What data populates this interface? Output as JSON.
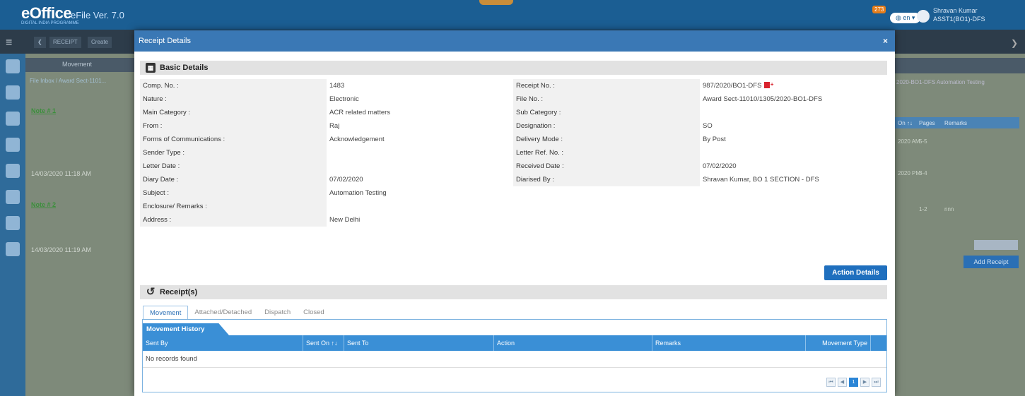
{
  "app": {
    "logo": "eOffice",
    "logo_sub": "DIGITAL INDIA PROGRAMME",
    "version": "eFile Ver. 7.0",
    "notification_count": "273",
    "language": "en",
    "user_name": "Shravan Kumar",
    "user_role": "ASST1(BO1)-DFS"
  },
  "breadcrumb_bar": {
    "receipt": "RECEIPT",
    "create": "Create"
  },
  "background": {
    "toolbar_label": "Movement",
    "file_link": "File Inbox / Award Sect-1101...",
    "notes": [
      {
        "label": "Note # 1",
        "time": "14/03/2020 11:18 AM"
      },
      {
        "label": "Note # 2",
        "time": "14/03/2020 11:19 AM"
      }
    ],
    "right_header": "2020-BO1-DFS  Automation Testing",
    "right_cols": [
      "On ↑↓",
      "Pages",
      "Remarks"
    ],
    "right_rows": [
      {
        "date": "2020 AM",
        "pages": "5-5",
        "remarks": ""
      },
      {
        "date": "2020 PM",
        "pages": "3-4",
        "remarks": ""
      },
      {
        "date": "",
        "pages": "1-2",
        "remarks": "nnn"
      }
    ],
    "add_receipt": "Add Receipt"
  },
  "modal": {
    "title": "Receipt Details",
    "close": "×",
    "basic_details_title": "Basic Details",
    "fields": [
      [
        "Comp. No. :",
        "1483",
        "Receipt No. :",
        "987/2020/BO1-DFS"
      ],
      [
        "Nature :",
        "Electronic",
        "File No. :",
        "Award Sect-11010/1305/2020-BO1-DFS"
      ],
      [
        "Main Category :",
        "ACR related matters",
        "Sub Category :",
        ""
      ],
      [
        "From :",
        "Raj",
        "Designation :",
        "SO"
      ],
      [
        "Forms of Communications :",
        "Acknowledgement",
        "Delivery Mode :",
        "By Post"
      ],
      [
        "Sender Type :",
        "",
        "Letter Ref. No. :",
        ""
      ],
      [
        "Letter Date :",
        "",
        "Received Date :",
        "07/02/2020"
      ],
      [
        "Diary Date :",
        "07/02/2020",
        "Diarised By :",
        "Shravan Kumar, BO 1 SECTION - DFS"
      ],
      [
        "Subject :",
        "Automation Testing",
        "",
        ""
      ],
      [
        "Enclosure/ Remarks :",
        "",
        "",
        ""
      ],
      [
        "Address :",
        "New Delhi",
        "",
        ""
      ]
    ],
    "action_details": "Action Details",
    "receipts_title": "Receipt(s)",
    "tabs": [
      "Movement",
      "Attached/Detached",
      "Dispatch",
      "Closed"
    ],
    "movement_history": "Movement History",
    "columns": [
      "Sent By",
      "Sent On ↑↓",
      "Sent To",
      "Action",
      "Remarks",
      "Movement Type"
    ],
    "empty": "No records found",
    "pager": [
      "⏮",
      "◀",
      "1",
      "▶",
      "⏭"
    ]
  }
}
